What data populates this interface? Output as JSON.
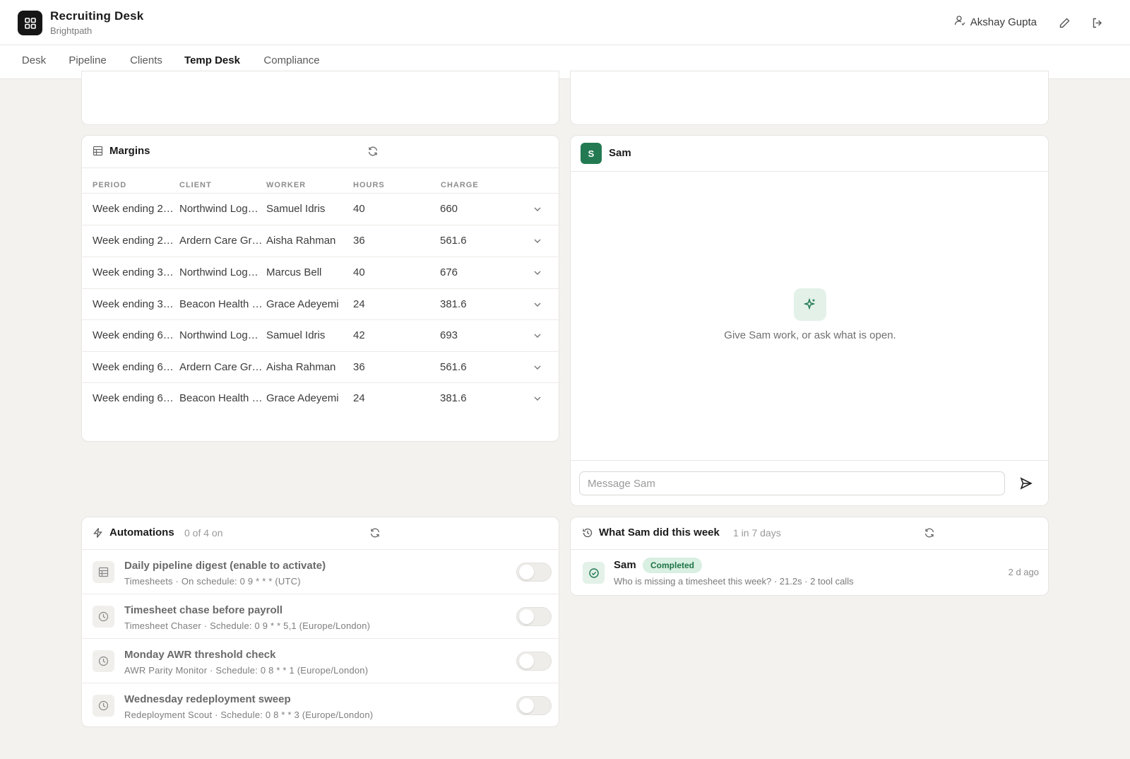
{
  "app": {
    "title": "Recruiting Desk",
    "subtitle": "Brightpath"
  },
  "header": {
    "user_name": "Akshay Gupta",
    "icons": [
      "user-icon",
      "edit-icon",
      "logout-icon"
    ]
  },
  "tabs": [
    {
      "label": "Desk",
      "active": false
    },
    {
      "label": "Pipeline",
      "active": false
    },
    {
      "label": "Clients",
      "active": false
    },
    {
      "label": "Temp Desk",
      "active": true
    },
    {
      "label": "Compliance",
      "active": false
    }
  ],
  "margins": {
    "title": "Margins",
    "columns": [
      "PERIOD",
      "CLIENT",
      "WORKER",
      "HOURS",
      "CHARGE"
    ],
    "rows": [
      {
        "period": "Week ending 2…",
        "client": "Northwind Log…",
        "worker": "Samuel Idris",
        "hours": "40",
        "charge": "660"
      },
      {
        "period": "Week ending 2…",
        "client": "Ardern Care Gr…",
        "worker": "Aisha Rahman",
        "hours": "36",
        "charge": "561.6"
      },
      {
        "period": "Week ending 3…",
        "client": "Northwind Log…",
        "worker": "Marcus Bell",
        "hours": "40",
        "charge": "676"
      },
      {
        "period": "Week ending 3…",
        "client": "Beacon Health …",
        "worker": "Grace Adeyemi",
        "hours": "24",
        "charge": "381.6"
      },
      {
        "period": "Week ending 6…",
        "client": "Northwind Log…",
        "worker": "Samuel Idris",
        "hours": "42",
        "charge": "693"
      },
      {
        "period": "Week ending 6…",
        "client": "Ardern Care Gr…",
        "worker": "Aisha Rahman",
        "hours": "36",
        "charge": "561.6"
      },
      {
        "period": "Week ending 6…",
        "client": "Beacon Health …",
        "worker": "Grace Adeyemi",
        "hours": "24",
        "charge": "381.6"
      }
    ]
  },
  "chat": {
    "avatar_letter": "S",
    "name": "Sam",
    "empty_text": "Give Sam work, or ask what is open.",
    "input_placeholder": "Message Sam"
  },
  "automations": {
    "title": "Automations",
    "count_label": "0 of 4 on",
    "items": [
      {
        "icon": "table-icon",
        "title": "Daily pipeline digest (enable to activate)",
        "desc": "Timesheets · On schedule: 0 9 * * * (UTC)",
        "enabled": false
      },
      {
        "icon": "clock-icon",
        "title": "Timesheet chase before payroll",
        "desc": "Timesheet Chaser · Schedule: 0 9 * * 5,1 (Europe/London)",
        "enabled": false
      },
      {
        "icon": "clock-icon",
        "title": "Monday AWR threshold check",
        "desc": "AWR Parity Monitor · Schedule: 0 8 * * 1 (Europe/London)",
        "enabled": false
      },
      {
        "icon": "clock-icon",
        "title": "Wednesday redeployment sweep",
        "desc": "Redeployment Scout · Schedule: 0 8 * * 3 (Europe/London)",
        "enabled": false
      }
    ]
  },
  "activity": {
    "title": "What Sam did this week",
    "count_label": "1 in 7 days",
    "items": [
      {
        "name": "Sam",
        "status": "Completed",
        "desc": "Who is missing a timesheet this week? · 21.2s · 2 tool calls",
        "time": "2 d ago"
      }
    ]
  },
  "colors": {
    "accent_green": "#237a52",
    "badge_bg": "#d8efe1",
    "page_bg": "#f3f2ef"
  }
}
